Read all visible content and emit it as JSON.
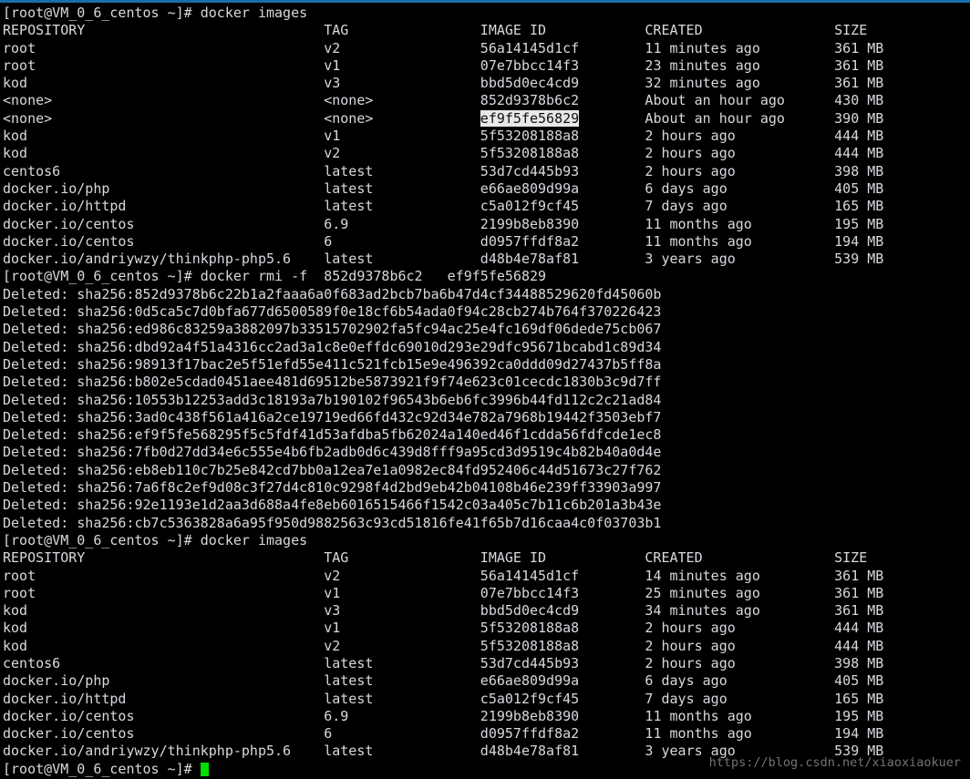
{
  "terminal": {
    "window_title": "root@VM_0_6_centos:~",
    "prompt": "[root@VM_0_6_centos ~]# ",
    "colors": {
      "background": "#000000",
      "foreground": "#d6d9de",
      "top_border": "#1a6ea8",
      "cursor": "#00e000",
      "selection_background": "#e8e8e8",
      "selection_foreground": "#101010",
      "watermark": "#6f7478"
    },
    "watermark": "https://blog.csdn.net/xiaoxiaokuer"
  },
  "commands": {
    "first": "docker images",
    "rmi": "docker rmi -f  852d9378b6c2   ef9f5fe56829",
    "second": "docker images"
  },
  "table_header": {
    "repository": "REPOSITORY",
    "tag": "TAG",
    "image_id": "IMAGE ID",
    "created": "CREATED",
    "size": "SIZE"
  },
  "images_before": [
    {
      "repository": "root",
      "tag": "v2",
      "image_id": "56a14145d1cf",
      "created": "11 minutes ago",
      "size": "361 MB",
      "highlighted": false
    },
    {
      "repository": "root",
      "tag": "v1",
      "image_id": "07e7bbcc14f3",
      "created": "23 minutes ago",
      "size": "361 MB",
      "highlighted": false
    },
    {
      "repository": "kod",
      "tag": "v3",
      "image_id": "bbd5d0ec4cd9",
      "created": "32 minutes ago",
      "size": "361 MB",
      "highlighted": false
    },
    {
      "repository": "<none>",
      "tag": "<none>",
      "image_id": "852d9378b6c2",
      "created": "About an hour ago",
      "size": "430 MB",
      "highlighted": false
    },
    {
      "repository": "<none>",
      "tag": "<none>",
      "image_id": "ef9f5fe56829",
      "created": "About an hour ago",
      "size": "390 MB",
      "highlighted": true
    },
    {
      "repository": "kod",
      "tag": "v1",
      "image_id": "5f53208188a8",
      "created": "2 hours ago",
      "size": "444 MB",
      "highlighted": false
    },
    {
      "repository": "kod",
      "tag": "v2",
      "image_id": "5f53208188a8",
      "created": "2 hours ago",
      "size": "444 MB",
      "highlighted": false
    },
    {
      "repository": "centos6",
      "tag": "latest",
      "image_id": "53d7cd445b93",
      "created": "2 hours ago",
      "size": "398 MB",
      "highlighted": false
    },
    {
      "repository": "docker.io/php",
      "tag": "latest",
      "image_id": "e66ae809d99a",
      "created": "6 days ago",
      "size": "405 MB",
      "highlighted": false
    },
    {
      "repository": "docker.io/httpd",
      "tag": "latest",
      "image_id": "c5a012f9cf45",
      "created": "7 days ago",
      "size": "165 MB",
      "highlighted": false
    },
    {
      "repository": "docker.io/centos",
      "tag": "6.9",
      "image_id": "2199b8eb8390",
      "created": "11 months ago",
      "size": "195 MB",
      "highlighted": false
    },
    {
      "repository": "docker.io/centos",
      "tag": "6",
      "image_id": "d0957ffdf8a2",
      "created": "11 months ago",
      "size": "194 MB",
      "highlighted": false
    },
    {
      "repository": "docker.io/andriywzy/thinkphp-php5.6",
      "tag": "latest",
      "image_id": "d48b4e78af81",
      "created": "3 years ago",
      "size": "539 MB",
      "highlighted": false
    }
  ],
  "deleted_lines": [
    "Deleted: sha256:852d9378b6c22b1a2faaa6a0f683ad2bcb7ba6b47d4cf34488529620fd45060b",
    "Deleted: sha256:0d5ca5c7d0bfa677d6500589f0e18cf6b54ada0f94c28cb274b764f370226423",
    "Deleted: sha256:ed986c83259a3882097b33515702902fa5fc94ac25e4fc169df06dede75cb067",
    "Deleted: sha256:dbd92a4f51a4316cc2ad3a1c8e0effdc69010d293e29dfc95671bcabd1c89d34",
    "Deleted: sha256:98913f17bac2e5f51efd55e411c521fcb15e9e496392ca0ddd09d27437b5ff8a",
    "Deleted: sha256:b802e5cdad0451aee481d69512be5873921f9f74e623c01cecdc1830b3c9d7ff",
    "Deleted: sha256:10553b12253add3c18193a7b190102f96543b6eb6fc3996b44fd112c2c21ad84",
    "Deleted: sha256:3ad0c438f561a416a2ce19719ed66fd432c92d34e782a7968b19442f3503ebf7",
    "Deleted: sha256:ef9f5fe568295f5c5fdf41d53afdba5fb62024a140ed46f1cdda56fdfcde1ec8",
    "Deleted: sha256:7fb0d27dd34e6c555e4b6fb2adb0d6c439d8fff9a95cd3d9519c4b82b40a0d4e",
    "Deleted: sha256:eb8eb110c7b25e842cd7bb0a12ea7e1a0982ec84fd952406c44d51673c27f762",
    "Deleted: sha256:7a6f8c2ef9d08c3f27d4c810c9298f4d2bd9eb42b04108b46e239ff33903a997",
    "Deleted: sha256:92e1193e1d2aa3d688a4fe8eb6016515466f1542c03a405c7b11c6b201a3b43e",
    "Deleted: sha256:cb7c5363828a6a95f950d9882563c93cd51816fe41f65b7d16caa4c0f03703b1"
  ],
  "images_after": [
    {
      "repository": "root",
      "tag": "v2",
      "image_id": "56a14145d1cf",
      "created": "14 minutes ago",
      "size": "361 MB"
    },
    {
      "repository": "root",
      "tag": "v1",
      "image_id": "07e7bbcc14f3",
      "created": "25 minutes ago",
      "size": "361 MB"
    },
    {
      "repository": "kod",
      "tag": "v3",
      "image_id": "bbd5d0ec4cd9",
      "created": "34 minutes ago",
      "size": "361 MB"
    },
    {
      "repository": "kod",
      "tag": "v1",
      "image_id": "5f53208188a8",
      "created": "2 hours ago",
      "size": "444 MB"
    },
    {
      "repository": "kod",
      "tag": "v2",
      "image_id": "5f53208188a8",
      "created": "2 hours ago",
      "size": "444 MB"
    },
    {
      "repository": "centos6",
      "tag": "latest",
      "image_id": "53d7cd445b93",
      "created": "2 hours ago",
      "size": "398 MB"
    },
    {
      "repository": "docker.io/php",
      "tag": "latest",
      "image_id": "e66ae809d99a",
      "created": "6 days ago",
      "size": "405 MB"
    },
    {
      "repository": "docker.io/httpd",
      "tag": "latest",
      "image_id": "c5a012f9cf45",
      "created": "7 days ago",
      "size": "165 MB"
    },
    {
      "repository": "docker.io/centos",
      "tag": "6.9",
      "image_id": "2199b8eb8390",
      "created": "11 months ago",
      "size": "195 MB"
    },
    {
      "repository": "docker.io/centos",
      "tag": "6",
      "image_id": "d0957ffdf8a2",
      "created": "11 months ago",
      "size": "194 MB"
    },
    {
      "repository": "docker.io/andriywzy/thinkphp-php5.6",
      "tag": "latest",
      "image_id": "d48b4e78af81",
      "created": "3 years ago",
      "size": "539 MB"
    }
  ],
  "layout": {
    "col_repository": 0,
    "col_tag": 39,
    "col_image_id": 58,
    "col_created": 78,
    "col_size": 101
  }
}
